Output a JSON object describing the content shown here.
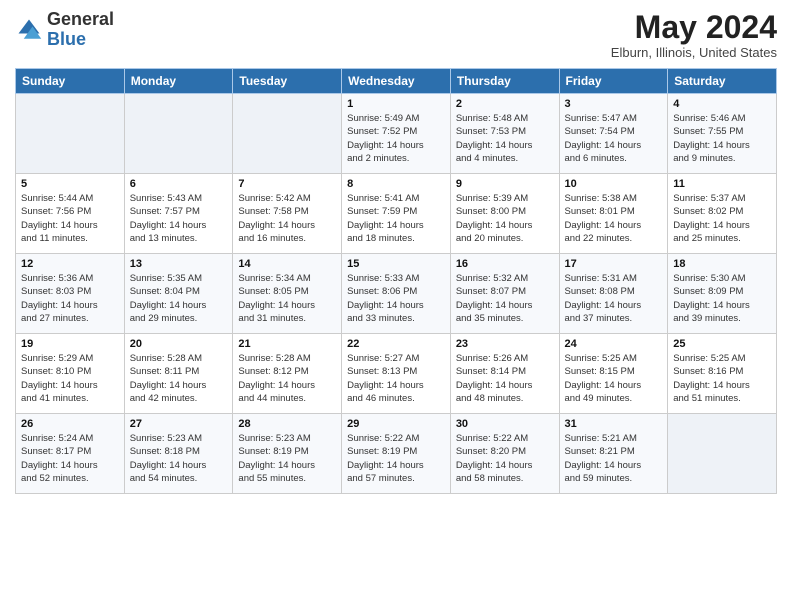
{
  "logo": {
    "general": "General",
    "blue": "Blue"
  },
  "header": {
    "title": "May 2024",
    "location": "Elburn, Illinois, United States"
  },
  "days_of_week": [
    "Sunday",
    "Monday",
    "Tuesday",
    "Wednesday",
    "Thursday",
    "Friday",
    "Saturday"
  ],
  "weeks": [
    [
      {
        "day": "",
        "info": ""
      },
      {
        "day": "",
        "info": ""
      },
      {
        "day": "",
        "info": ""
      },
      {
        "day": "1",
        "info": "Sunrise: 5:49 AM\nSunset: 7:52 PM\nDaylight: 14 hours\nand 2 minutes."
      },
      {
        "day": "2",
        "info": "Sunrise: 5:48 AM\nSunset: 7:53 PM\nDaylight: 14 hours\nand 4 minutes."
      },
      {
        "day": "3",
        "info": "Sunrise: 5:47 AM\nSunset: 7:54 PM\nDaylight: 14 hours\nand 6 minutes."
      },
      {
        "day": "4",
        "info": "Sunrise: 5:46 AM\nSunset: 7:55 PM\nDaylight: 14 hours\nand 9 minutes."
      }
    ],
    [
      {
        "day": "5",
        "info": "Sunrise: 5:44 AM\nSunset: 7:56 PM\nDaylight: 14 hours\nand 11 minutes."
      },
      {
        "day": "6",
        "info": "Sunrise: 5:43 AM\nSunset: 7:57 PM\nDaylight: 14 hours\nand 13 minutes."
      },
      {
        "day": "7",
        "info": "Sunrise: 5:42 AM\nSunset: 7:58 PM\nDaylight: 14 hours\nand 16 minutes."
      },
      {
        "day": "8",
        "info": "Sunrise: 5:41 AM\nSunset: 7:59 PM\nDaylight: 14 hours\nand 18 minutes."
      },
      {
        "day": "9",
        "info": "Sunrise: 5:39 AM\nSunset: 8:00 PM\nDaylight: 14 hours\nand 20 minutes."
      },
      {
        "day": "10",
        "info": "Sunrise: 5:38 AM\nSunset: 8:01 PM\nDaylight: 14 hours\nand 22 minutes."
      },
      {
        "day": "11",
        "info": "Sunrise: 5:37 AM\nSunset: 8:02 PM\nDaylight: 14 hours\nand 25 minutes."
      }
    ],
    [
      {
        "day": "12",
        "info": "Sunrise: 5:36 AM\nSunset: 8:03 PM\nDaylight: 14 hours\nand 27 minutes."
      },
      {
        "day": "13",
        "info": "Sunrise: 5:35 AM\nSunset: 8:04 PM\nDaylight: 14 hours\nand 29 minutes."
      },
      {
        "day": "14",
        "info": "Sunrise: 5:34 AM\nSunset: 8:05 PM\nDaylight: 14 hours\nand 31 minutes."
      },
      {
        "day": "15",
        "info": "Sunrise: 5:33 AM\nSunset: 8:06 PM\nDaylight: 14 hours\nand 33 minutes."
      },
      {
        "day": "16",
        "info": "Sunrise: 5:32 AM\nSunset: 8:07 PM\nDaylight: 14 hours\nand 35 minutes."
      },
      {
        "day": "17",
        "info": "Sunrise: 5:31 AM\nSunset: 8:08 PM\nDaylight: 14 hours\nand 37 minutes."
      },
      {
        "day": "18",
        "info": "Sunrise: 5:30 AM\nSunset: 8:09 PM\nDaylight: 14 hours\nand 39 minutes."
      }
    ],
    [
      {
        "day": "19",
        "info": "Sunrise: 5:29 AM\nSunset: 8:10 PM\nDaylight: 14 hours\nand 41 minutes."
      },
      {
        "day": "20",
        "info": "Sunrise: 5:28 AM\nSunset: 8:11 PM\nDaylight: 14 hours\nand 42 minutes."
      },
      {
        "day": "21",
        "info": "Sunrise: 5:28 AM\nSunset: 8:12 PM\nDaylight: 14 hours\nand 44 minutes."
      },
      {
        "day": "22",
        "info": "Sunrise: 5:27 AM\nSunset: 8:13 PM\nDaylight: 14 hours\nand 46 minutes."
      },
      {
        "day": "23",
        "info": "Sunrise: 5:26 AM\nSunset: 8:14 PM\nDaylight: 14 hours\nand 48 minutes."
      },
      {
        "day": "24",
        "info": "Sunrise: 5:25 AM\nSunset: 8:15 PM\nDaylight: 14 hours\nand 49 minutes."
      },
      {
        "day": "25",
        "info": "Sunrise: 5:25 AM\nSunset: 8:16 PM\nDaylight: 14 hours\nand 51 minutes."
      }
    ],
    [
      {
        "day": "26",
        "info": "Sunrise: 5:24 AM\nSunset: 8:17 PM\nDaylight: 14 hours\nand 52 minutes."
      },
      {
        "day": "27",
        "info": "Sunrise: 5:23 AM\nSunset: 8:18 PM\nDaylight: 14 hours\nand 54 minutes."
      },
      {
        "day": "28",
        "info": "Sunrise: 5:23 AM\nSunset: 8:19 PM\nDaylight: 14 hours\nand 55 minutes."
      },
      {
        "day": "29",
        "info": "Sunrise: 5:22 AM\nSunset: 8:19 PM\nDaylight: 14 hours\nand 57 minutes."
      },
      {
        "day": "30",
        "info": "Sunrise: 5:22 AM\nSunset: 8:20 PM\nDaylight: 14 hours\nand 58 minutes."
      },
      {
        "day": "31",
        "info": "Sunrise: 5:21 AM\nSunset: 8:21 PM\nDaylight: 14 hours\nand 59 minutes."
      },
      {
        "day": "",
        "info": ""
      }
    ]
  ]
}
